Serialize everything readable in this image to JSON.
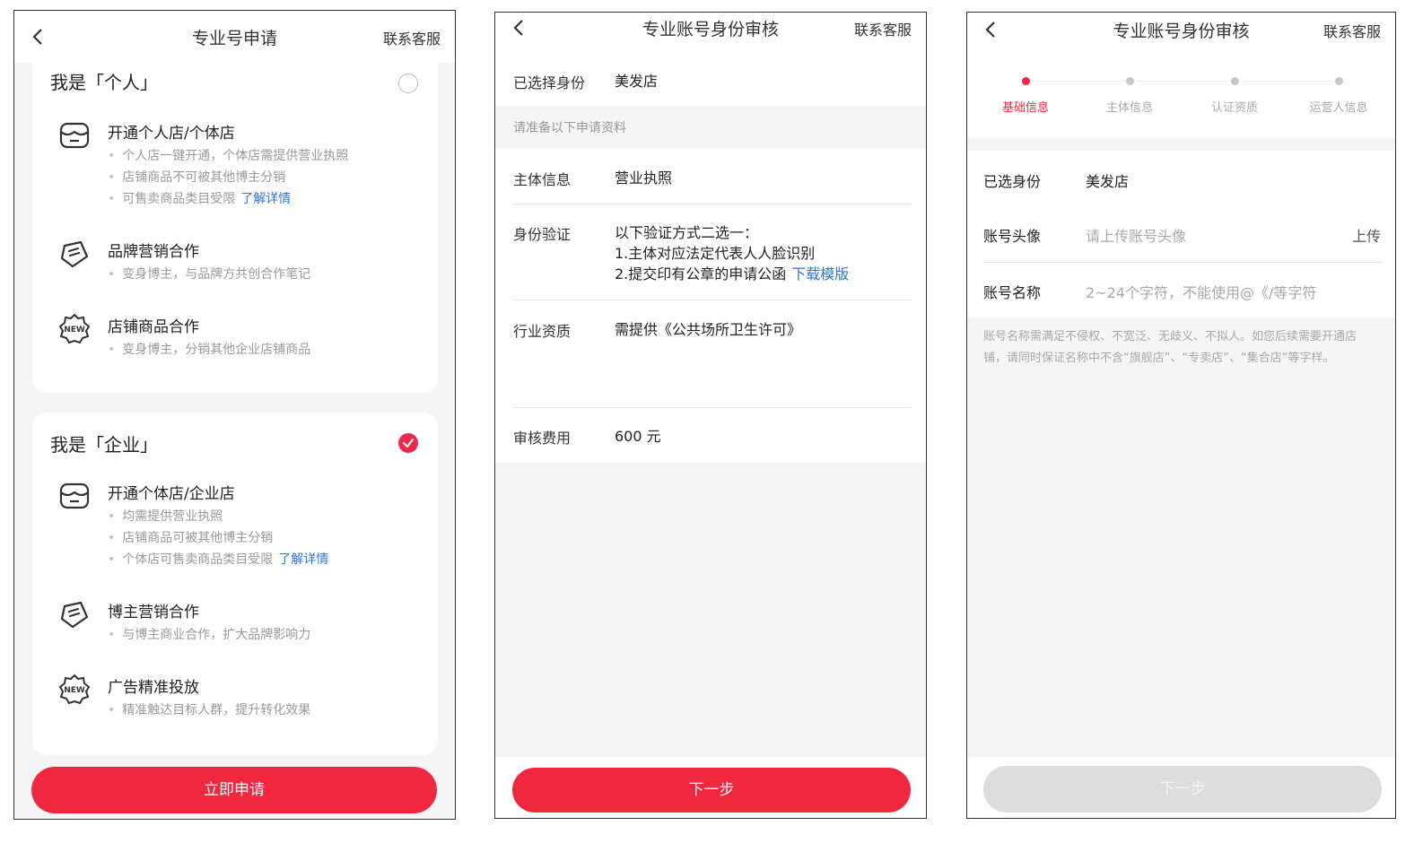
{
  "screen1": {
    "title": "专业号申请",
    "customer_service": "联系客服",
    "personal": {
      "title": "我是「个人」",
      "features": [
        {
          "icon": "store-icon",
          "name": "开通个人店/个体店",
          "bullets": [
            "个人店一键开通，个体店需提供营业执照",
            "店铺商品不可被其他博主分销",
            "可售卖商品类目受限"
          ],
          "link": "了解详情"
        },
        {
          "icon": "brand-tag-icon",
          "name": "品牌营销合作",
          "bullets": [
            "变身博主，与品牌方共创合作笔记"
          ]
        },
        {
          "icon": "new-badge-icon",
          "name": "店铺商品合作",
          "bullets": [
            "变身博主，分销其他企业店铺商品"
          ]
        }
      ]
    },
    "enterprise": {
      "title": "我是「企业」",
      "features": [
        {
          "icon": "store-icon",
          "name": "开通个体店/企业店",
          "bullets": [
            "均需提供营业执照",
            "店铺商品可被其他博主分销",
            "个体店可售卖商品类目受限"
          ],
          "link": "了解详情"
        },
        {
          "icon": "brand-tag-icon",
          "name": "博主营销合作",
          "bullets": [
            "与博主商业合作，扩大品牌影响力"
          ]
        },
        {
          "icon": "new-badge-icon",
          "name": "广告精准投放",
          "bullets": [
            "精准触达目标人群，提升转化效果"
          ]
        }
      ]
    },
    "apply_button": "立即申请"
  },
  "screen2": {
    "title": "专业账号身份审核",
    "customer_service": "联系客服",
    "selected_label": "已选择身份",
    "selected_value": "美发店",
    "hint": "请准备以下申请资料",
    "rows": [
      {
        "label": "主体信息",
        "lines": [
          "营业执照"
        ]
      },
      {
        "label": "身份验证",
        "lines": [
          "以下验证方式二选一：",
          "1.主体对应法定代表人人脸识别",
          "2.提交印有公章的申请公函"
        ],
        "link": "下载模版"
      },
      {
        "label": "行业资质",
        "lines": [
          "需提供《公共场所卫生许可》"
        ]
      },
      {
        "label": "审核费用",
        "lines": [
          "600 元"
        ]
      }
    ],
    "next_button": "下一步"
  },
  "screen3": {
    "title": "专业账号身份审核",
    "customer_service": "联系客服",
    "steps": [
      "基础信息",
      "主体信息",
      "认证资质",
      "运营人信息"
    ],
    "active_step": 0,
    "selected_label": "已选身份",
    "selected_value": "美发店",
    "avatar_label": "账号头像",
    "avatar_placeholder": "请上传账号头像",
    "avatar_action": "上传",
    "name_label": "账号名称",
    "name_placeholder": "2~24个字符，不能使用@《/等字符",
    "note": "账号名称需满足不侵权、不宽泛、无歧义、不拟人。如您后续需要开通店铺，请同时保证名称中不含“旗舰店”、“专卖店”、“集合店”等字样。",
    "next_button": "下一步"
  },
  "colors": {
    "accent": "#f0283f",
    "link": "#2f76d8",
    "disabled": "#dddddd"
  }
}
